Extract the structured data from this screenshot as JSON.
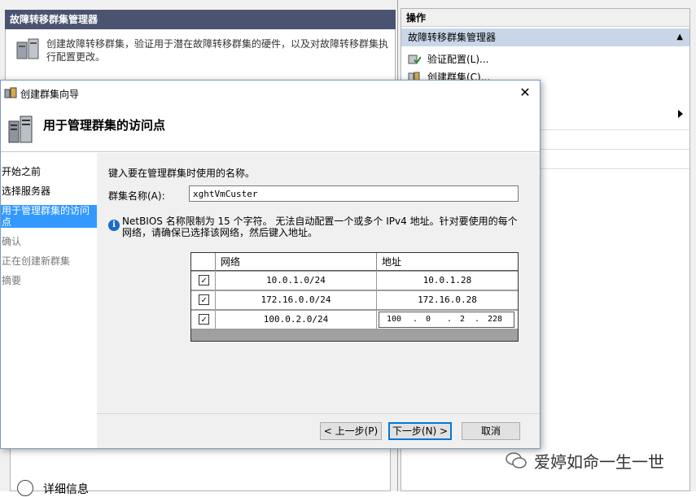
{
  "background": {
    "left_panel_title": "故障转移群集管理器",
    "left_panel_description": "创建故障转移群集，验证用于潜在故障转移群集的硬件，以及对故障转移群集执行配置更改。",
    "detail_label": "详细信息",
    "actions_title": "操作",
    "actions_subtitle": "故障转移群集管理器",
    "action_items": [
      "验证配置(L)...",
      "创建群集(C)..."
    ]
  },
  "wizard": {
    "window_title": "创建群集向导",
    "page_title": "用于管理群集的访问点",
    "steps": [
      {
        "label": "开始之前",
        "state": "done"
      },
      {
        "label": "选择服务器",
        "state": "done"
      },
      {
        "label": "用于管理群集的访问点",
        "state": "active"
      },
      {
        "label": "确认",
        "state": "disabled"
      },
      {
        "label": "正在创建新群集",
        "state": "disabled"
      },
      {
        "label": "摘要",
        "state": "disabled"
      }
    ],
    "instruction": "键入要在管理群集时使用的名称。",
    "name_label": "群集名称(A):",
    "name_value": "xghtVmCuster",
    "info_text": "NetBIOS 名称限制为 15 个字符。 无法自动配置一个或多个 IPv4 地址。针对要使用的每个网络，请确保已选择该网络，然后键入地址。",
    "grid_headers": {
      "network": "网络",
      "address": "地址"
    },
    "networks": [
      {
        "checked": true,
        "network": "10.0.1.0/24",
        "address": "10.0.1.28"
      },
      {
        "checked": true,
        "network": "172.16.0.0/24",
        "address": "172.16.0.28"
      },
      {
        "checked": true,
        "network": "100.0.2.0/24",
        "address_parts": [
          "100",
          "0",
          "2",
          "228"
        ]
      }
    ],
    "buttons": {
      "back": "< 上一步(P)",
      "next": "下一步(N) >",
      "cancel": "取消"
    }
  },
  "watermark": "爱婷如命一生一世",
  "colors": {
    "active_step": "#3399ff",
    "actions_subheader": "#c9d6e8",
    "left_title_bar": "#4a5470"
  }
}
